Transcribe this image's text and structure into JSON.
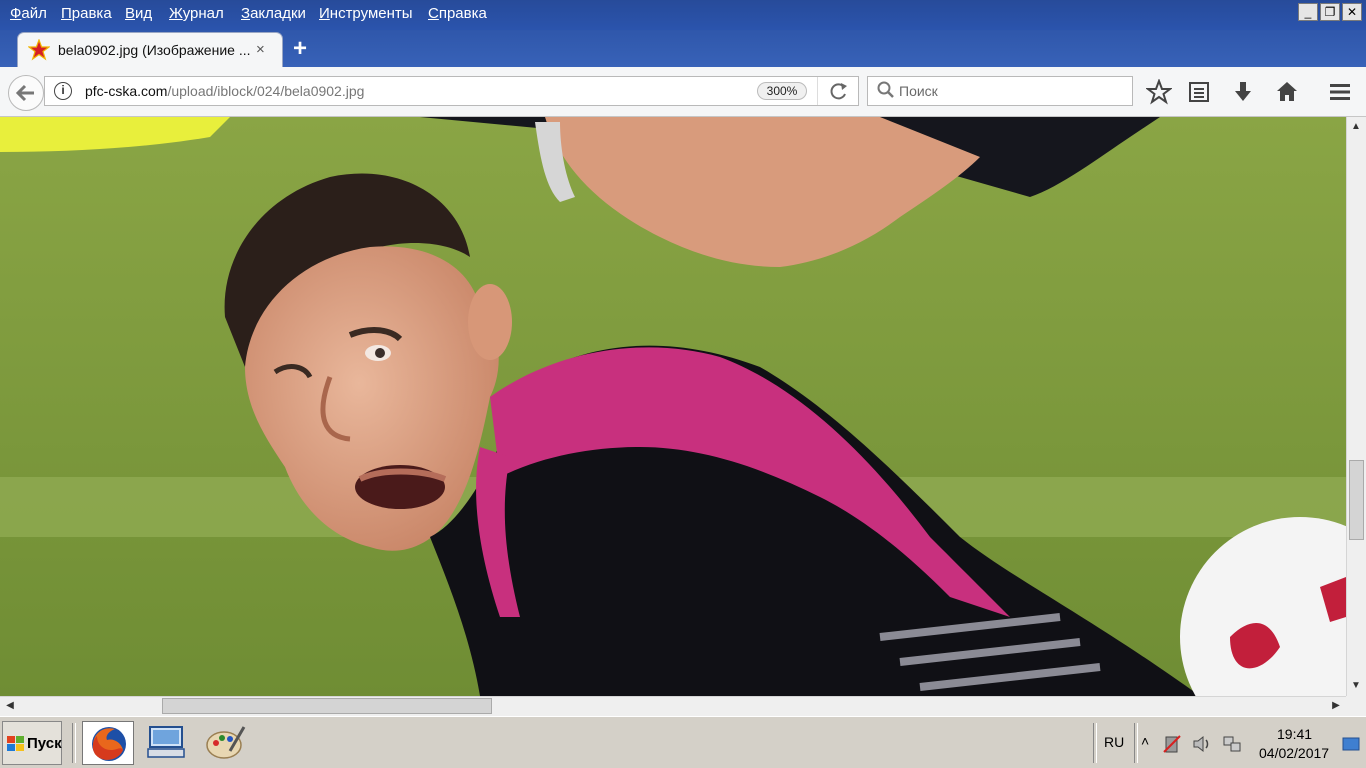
{
  "menubar": {
    "items": [
      "Файл",
      "Правка",
      "Вид",
      "Журнал",
      "Закладки",
      "Инструменты",
      "Справка"
    ],
    "window_buttons": [
      "_",
      "❐",
      "✕"
    ]
  },
  "tab": {
    "title": "bela0902.jpg (Изображение ...",
    "close": "×"
  },
  "newtab_label": "+",
  "urlbar": {
    "domain": "pfc-cska.com",
    "path": "/upload/iblock/024/bela0902.jpg",
    "zoom": "300%"
  },
  "search": {
    "placeholder": "Поиск"
  },
  "taskbar": {
    "start_label": "Пуск",
    "language": "RU",
    "tray_arrow": "˄",
    "time": "19:41",
    "date": "04/02/2017"
  },
  "colors": {
    "titlebar": "#2b54ad",
    "toolbar": "#f5f6f7",
    "taskbar": "#d4d0c8",
    "jersey_pink": "#c8307e"
  }
}
